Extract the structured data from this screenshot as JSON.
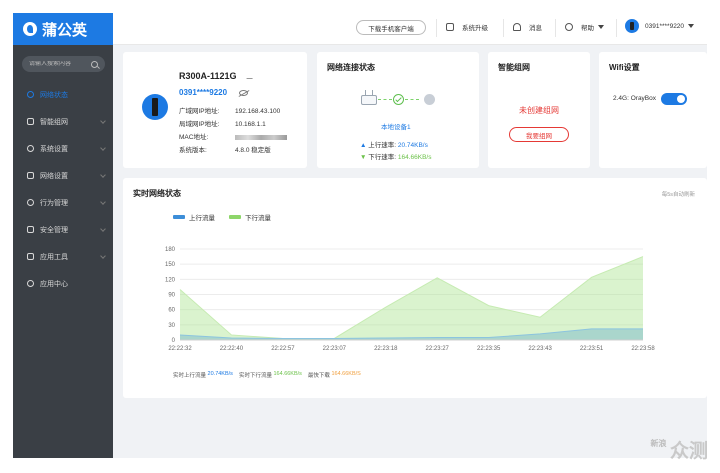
{
  "app": {
    "name": "蒲公英"
  },
  "sidebar": {
    "search_placeholder": "请输入搜索内容",
    "items": [
      {
        "label": "网络状态",
        "active": true
      },
      {
        "label": "智能组网"
      },
      {
        "label": "系统设置"
      },
      {
        "label": "网络设置"
      },
      {
        "label": "行为管理"
      },
      {
        "label": "安全管理"
      },
      {
        "label": "应用工具"
      },
      {
        "label": "应用中心"
      }
    ]
  },
  "topbar": {
    "download_app": "下载手机客户端",
    "upgrade": "系统升级",
    "messages": "消息",
    "help": "帮助",
    "account": "0391****9220"
  },
  "device": {
    "model": "R300A-1121G",
    "user": "0391****9220",
    "wan_ip_label": "广域网IP地址:",
    "wan_ip": "192.168.43.100",
    "lan_ip_label": "局域网IP地址:",
    "lan_ip": "10.168.1.1",
    "mac_label": "MAC地址:",
    "version_label": "系统版本:",
    "version": "4.8.0 稳定版"
  },
  "network": {
    "title": "网络连接状态",
    "local_device": "本地设备1",
    "up_label": "上行速率:",
    "up_value": "20.74KB/s",
    "down_label": "下行速率:",
    "down_value": "164.66KB/s"
  },
  "mesh": {
    "title": "智能组网",
    "status": "未创建组网",
    "button": "我要组网"
  },
  "wifi": {
    "title": "Wifi设置",
    "band": "2.4G:",
    "ssid": "OrayBox",
    "enabled": true
  },
  "realtime": {
    "title": "实时网络状态",
    "refresh_note": "每5s自动刷新",
    "legend_up": "上行流量",
    "legend_down": "下行流量",
    "stat_up_label": "实时上行流量",
    "stat_up": "20.74KB/s",
    "stat_down_label": "实时下行流量",
    "stat_down": "164.66KB/s",
    "stat_max_label": "最快下载",
    "stat_max": "164.66KB/S"
  },
  "chart_data": {
    "type": "area",
    "x": [
      "22:22:32",
      "22:22:40",
      "22:22:57",
      "22:23:07",
      "22:23:18",
      "22:23:27",
      "22:23:35",
      "22:23:43",
      "22:23:51",
      "22:23:58"
    ],
    "ylim": [
      0,
      180
    ],
    "yticks": [
      0,
      30,
      60,
      90,
      120,
      150,
      180
    ],
    "series": [
      {
        "name": "上行流量",
        "color": "#3d8ed8",
        "values": [
          10,
          4,
          3,
          3,
          4,
          5,
          5,
          12,
          22,
          22
        ]
      },
      {
        "name": "下行流量",
        "color": "#8ed66a",
        "values": [
          100,
          10,
          3,
          3,
          65,
          123,
          68,
          45,
          124,
          165
        ]
      }
    ],
    "grid": true
  },
  "watermark": {
    "box": "新浪",
    "text": "众测"
  }
}
